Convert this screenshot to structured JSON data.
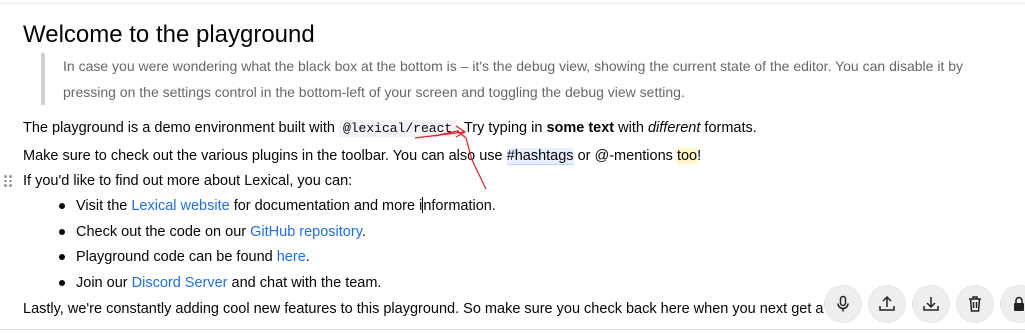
{
  "editor": {
    "title": "Welcome to the playground",
    "quote": {
      "line1": "In case you were wondering what the black box at the bottom is – it's the debug view, showing the current state of the editor. You can disable it by",
      "line2": "pressing on the settings control in the bottom-left of your screen and toggling the debug view setting."
    },
    "para1": {
      "before": "The playground is a demo environment built with ",
      "code": "@lexical/react",
      "mid": ". Try typing in ",
      "bold": "some text",
      "with": " with ",
      "italic": "different",
      "after": " formats."
    },
    "para2": {
      "before": "Make sure to check out the various plugins in the toolbar. You can also use ",
      "hashtag": "#hashtags",
      "mid": " or @-mentions ",
      "highlight": "too",
      "after": "!"
    },
    "para3": "If you'd like to find out more about Lexical, you can:",
    "list": [
      {
        "before": "Visit the ",
        "link": "Lexical website",
        "after_a": " for documentation and more i",
        "after_b": "nformation."
      },
      {
        "before": "Check out the code on our ",
        "link": "GitHub repository",
        "after": "."
      },
      {
        "before": "Playground code can be found ",
        "link": "here",
        "after": "."
      },
      {
        "before": "Join our ",
        "link": "Discord Server",
        "after": " and chat with the team."
      }
    ],
    "para4": "Lastly, we're constantly adding cool new features to this playground. So make sure you check back here when you next get a c"
  },
  "actions": {
    "icons": [
      "microphone-icon",
      "upload-icon",
      "download-icon",
      "trash-icon",
      "lock-icon"
    ]
  },
  "colors": {
    "link": "#216fdb",
    "annotation": "#e0202b"
  }
}
